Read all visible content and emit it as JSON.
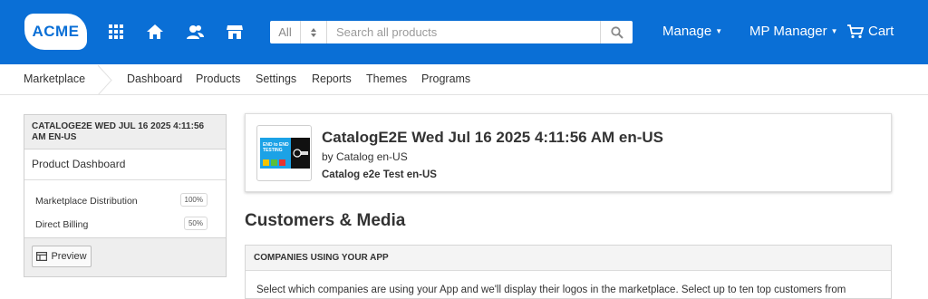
{
  "topbar": {
    "logo": "ACME",
    "search": {
      "scope": "All",
      "placeholder": "Search all products"
    },
    "manage": "Manage",
    "mp_manager": "MP Manager",
    "cart": "Cart",
    "bg_color": "#0a6fd6"
  },
  "subnav": {
    "marketplace": "Marketplace",
    "items": [
      "Dashboard",
      "Products",
      "Settings",
      "Reports",
      "Themes",
      "Programs"
    ]
  },
  "sidebar": {
    "title": "CATALOGE2E WED JUL 16 2025 4:11:56 AM EN-US",
    "dashboard": "Product Dashboard",
    "rows": [
      {
        "label": "Marketplace Distribution",
        "value": "100%"
      },
      {
        "label": "Direct Billing",
        "value": "50%"
      }
    ],
    "preview": "Preview"
  },
  "product": {
    "name": "CatalogE2E Wed Jul 16 2025 4:11:56 AM en-US",
    "by": "by Catalog en-US",
    "subtitle": "Catalog e2e Test en-US",
    "thumb_text": "END to END TESTING"
  },
  "section_title": "Customers & Media",
  "panel": {
    "title": "COMPANIES USING YOUR APP",
    "text": "Select which companies are using your App and we'll display their logos in the marketplace. Select up to ten top customers from"
  }
}
